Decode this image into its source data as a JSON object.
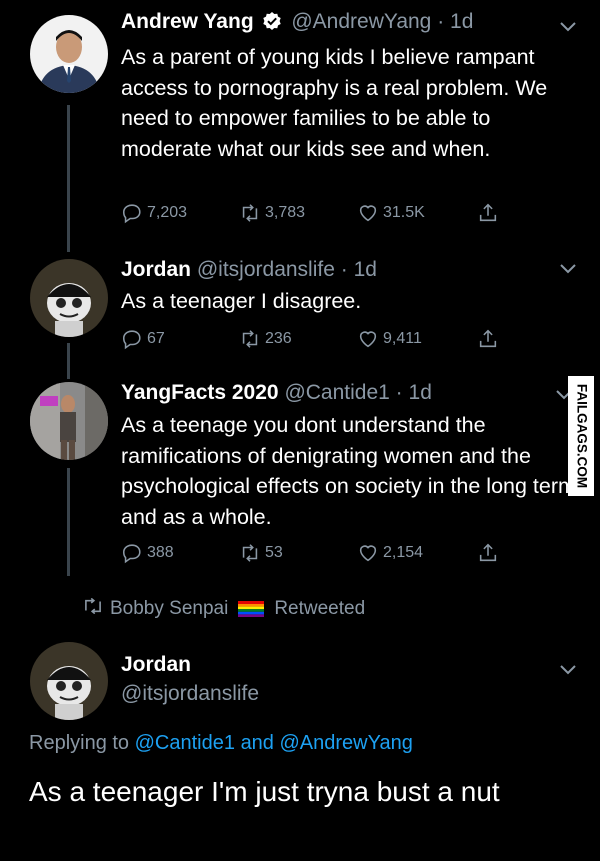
{
  "tweets": [
    {
      "name": "Andrew Yang",
      "handle": "@AndrewYang",
      "dot": "·",
      "time": "1d",
      "text": "As a parent of young kids I believe rampant access to pornography is a real problem. We need to empower families to be able to moderate what our kids see and when.",
      "replies": "7,203",
      "retweets": "3,783",
      "likes": "31.5K"
    },
    {
      "name": "Jordan",
      "handle": "@itsjordanslife",
      "dot": "·",
      "time": "1d",
      "text": "As a teenager I disagree.",
      "replies": "67",
      "retweets": "236",
      "likes": "9,411"
    },
    {
      "name": "YangFacts 2020",
      "handle": "@Cantide1",
      "dot": "·",
      "time": "1d",
      "text": "As a teenage you dont understand the ramifications of denigrating women and the psychological effects on society in the long term and as a whole.",
      "replies": "388",
      "retweets": "53",
      "likes": "2,154"
    }
  ],
  "retweet_banner": {
    "user": "Bobby Senpai",
    "suffix": "Retweeted"
  },
  "main_tweet": {
    "name": "Jordan",
    "handle": "@itsjordanslife",
    "replying_prefix": "Replying to",
    "replying_to_1": "@Cantide1",
    "replying_and": "and",
    "replying_to_2": "@AndrewYang",
    "text": "As a teenager I'm just tryna bust a nut"
  },
  "watermark": "FAILGAGS.COM",
  "colors": {
    "background": "#000000",
    "secondary_text": "#8b98a5",
    "link": "#1da1f2",
    "verified": "#ffffff",
    "thread_line": "#3a444c"
  },
  "icons": [
    "verified-badge-icon",
    "chevron-down-icon",
    "reply-icon",
    "retweet-icon",
    "like-icon",
    "share-icon",
    "rainbow-flag-icon"
  ]
}
